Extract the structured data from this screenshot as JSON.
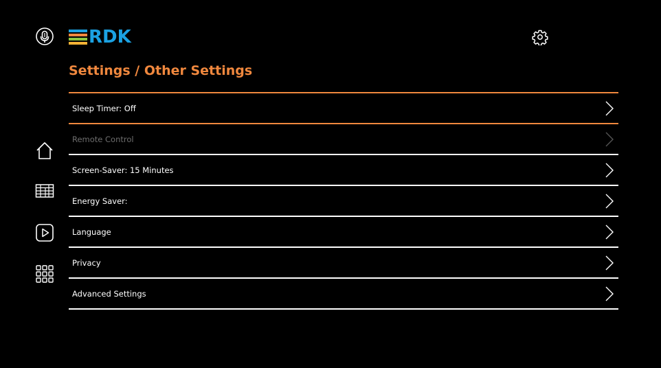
{
  "header": {
    "logo_text": "RDK",
    "logo_colors": [
      "#1ba1e2",
      "#f0883e",
      "#8cc63f",
      "#f5b335"
    ]
  },
  "page_title": "Settings / Other Settings",
  "nav": {
    "icons": [
      "microphone-icon",
      "home-icon",
      "guide-icon",
      "play-icon",
      "apps-icon",
      "gear-icon"
    ]
  },
  "colors": {
    "accent": "#f0883e",
    "background": "#000000",
    "text": "#ffffff",
    "disabled": "#6e6e6e"
  },
  "settings": {
    "items": [
      {
        "label": "Sleep Timer: Off",
        "state": "focused"
      },
      {
        "label": "Remote Control",
        "state": "disabled"
      },
      {
        "label": "Screen-Saver: 15 Minutes",
        "state": "normal"
      },
      {
        "label": "Energy Saver:",
        "state": "normal"
      },
      {
        "label": "Language",
        "state": "normal"
      },
      {
        "label": "Privacy",
        "state": "normal"
      },
      {
        "label": "Advanced Settings",
        "state": "normal"
      }
    ]
  }
}
